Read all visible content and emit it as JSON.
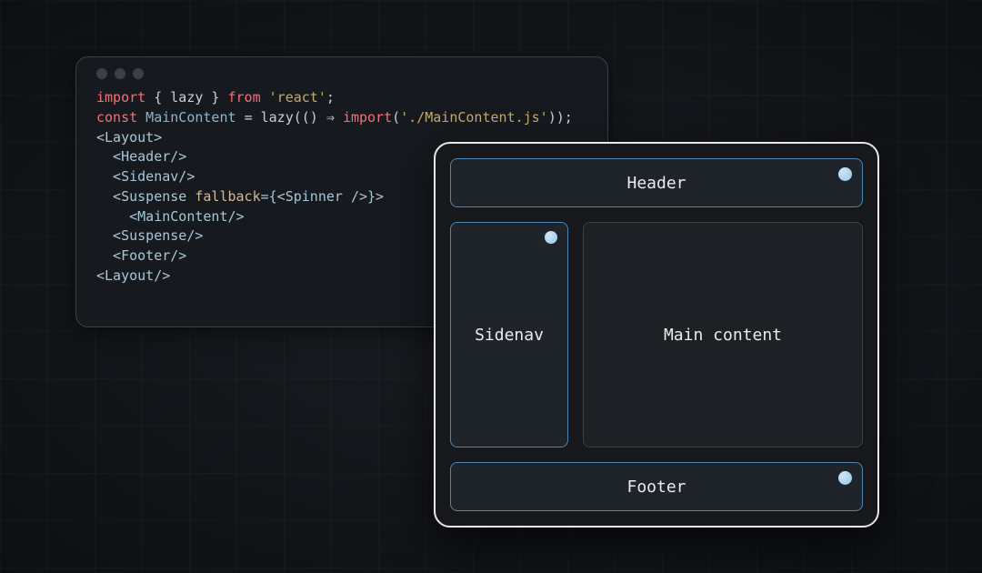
{
  "code": {
    "line1_a": "import",
    "line1_b": " { lazy } ",
    "line1_c": "from",
    "line1_d": " 'react'",
    "line1_e": ";",
    "line2_a": "const",
    "line2_b": " MainContent ",
    "line2_c": "= lazy(() ⇒ ",
    "line2_d": "import",
    "line2_e": "(",
    "line2_f": "'./MainContent.js'",
    "line2_g": "));",
    "line3": "",
    "line4": "<Layout>",
    "line5": "  <Header/>",
    "line6": "  <Sidenav/>",
    "line7_a": "  <Suspense ",
    "line7_b": "fallback",
    "line7_c": "={<Spinner />}>",
    "line8": "    <MainContent/>",
    "line9": "  <Suspense/>",
    "line10": "  <Footer/>",
    "line11": "<Layout/>"
  },
  "layout": {
    "header": "Header",
    "sidenav": "Sidenav",
    "main": "Main content",
    "footer": "Footer"
  }
}
